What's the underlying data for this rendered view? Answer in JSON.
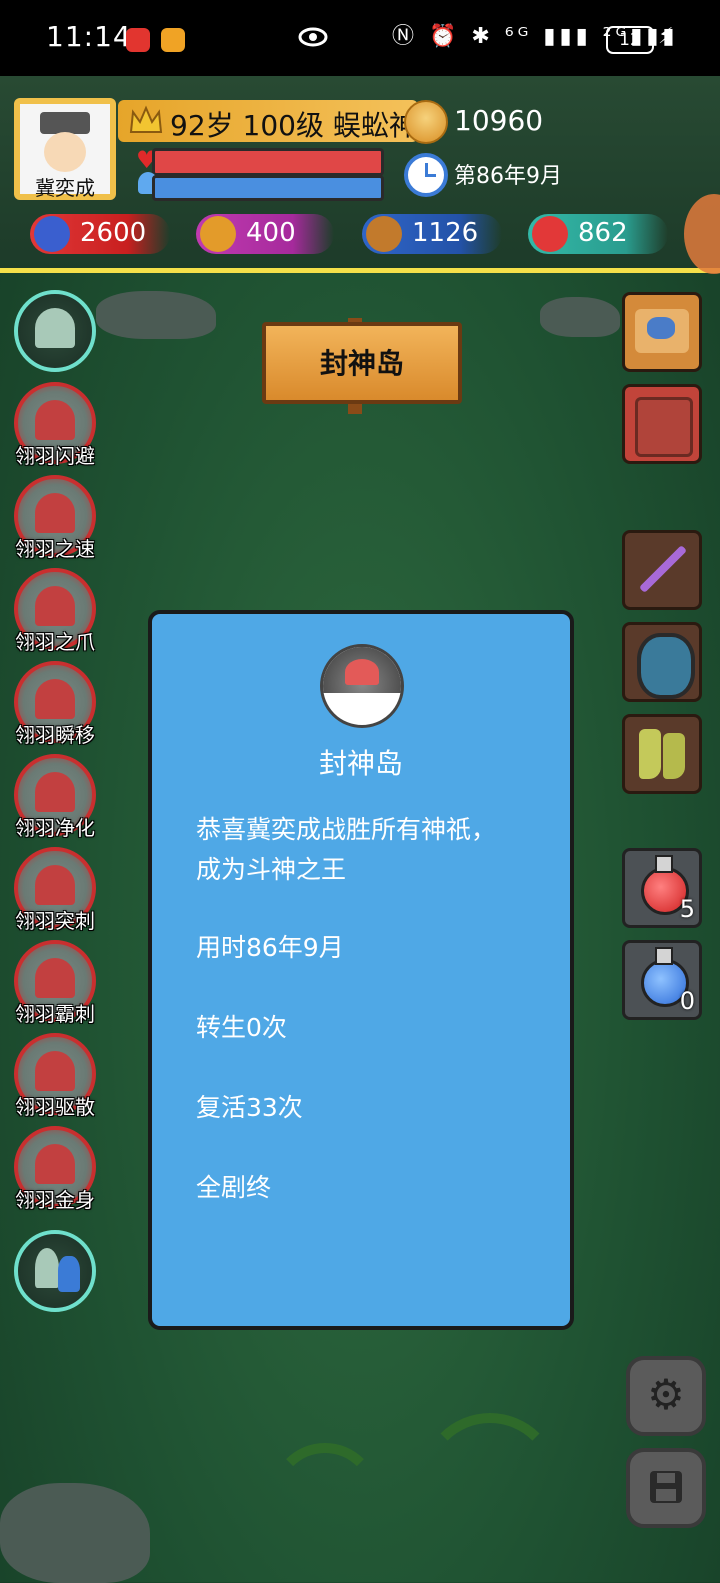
{
  "status_bar": {
    "time": "11:14",
    "icons": "Ⓝ ⏰ ✱ ⁶ᴳ ▮▮▮ ²ᴳ▮▮▮",
    "battery": "12"
  },
  "player": {
    "name": "冀奕成",
    "title": "92岁 100级 蜈蚣神",
    "gold": "10960",
    "game_time": "第86年9月",
    "hp_fraction": 1.0,
    "mp_fraction": 1.0
  },
  "stats": [
    {
      "name": "attack",
      "value": "2600",
      "icon": "sword-icon",
      "color": "#e23838"
    },
    {
      "name": "defense",
      "value": "400",
      "icon": "shield-icon",
      "color": "#c03ab0"
    },
    {
      "name": "speed",
      "value": "1126",
      "icon": "boot-icon",
      "color": "#2f65c8"
    },
    {
      "name": "health",
      "value": "862",
      "icon": "heart-plus-icon",
      "color": "#33b8a8"
    }
  ],
  "location": {
    "sign": "封神岛"
  },
  "skills": [
    {
      "label": "翎羽闪避"
    },
    {
      "label": "翎羽之速"
    },
    {
      "label": "翎羽之爪"
    },
    {
      "label": "翎羽瞬移"
    },
    {
      "label": "翎羽净化"
    },
    {
      "label": "翎羽突刺"
    },
    {
      "label": "翎羽霸刺"
    },
    {
      "label": "翎羽驱散"
    },
    {
      "label": "翎羽金身"
    }
  ],
  "items": {
    "red_potion_count": "5",
    "blue_potion_count": "0"
  },
  "dialog": {
    "title": "封神岛",
    "line1": "恭喜冀奕成战胜所有神祇，",
    "line2": "成为斗神之王",
    "line3": "用时86年9月",
    "line4": "转生0次",
    "line5": "复活33次",
    "line6": "全剧终"
  },
  "colors": {
    "header_underline": "#f5e04a",
    "dialog_bg": "#4fa8e6",
    "hp_bar": "#e04747",
    "mp_bar": "#4a8fe0",
    "skill_active_ring": "#6fe0cc",
    "skill_locked_ring": "#c92f2f"
  }
}
